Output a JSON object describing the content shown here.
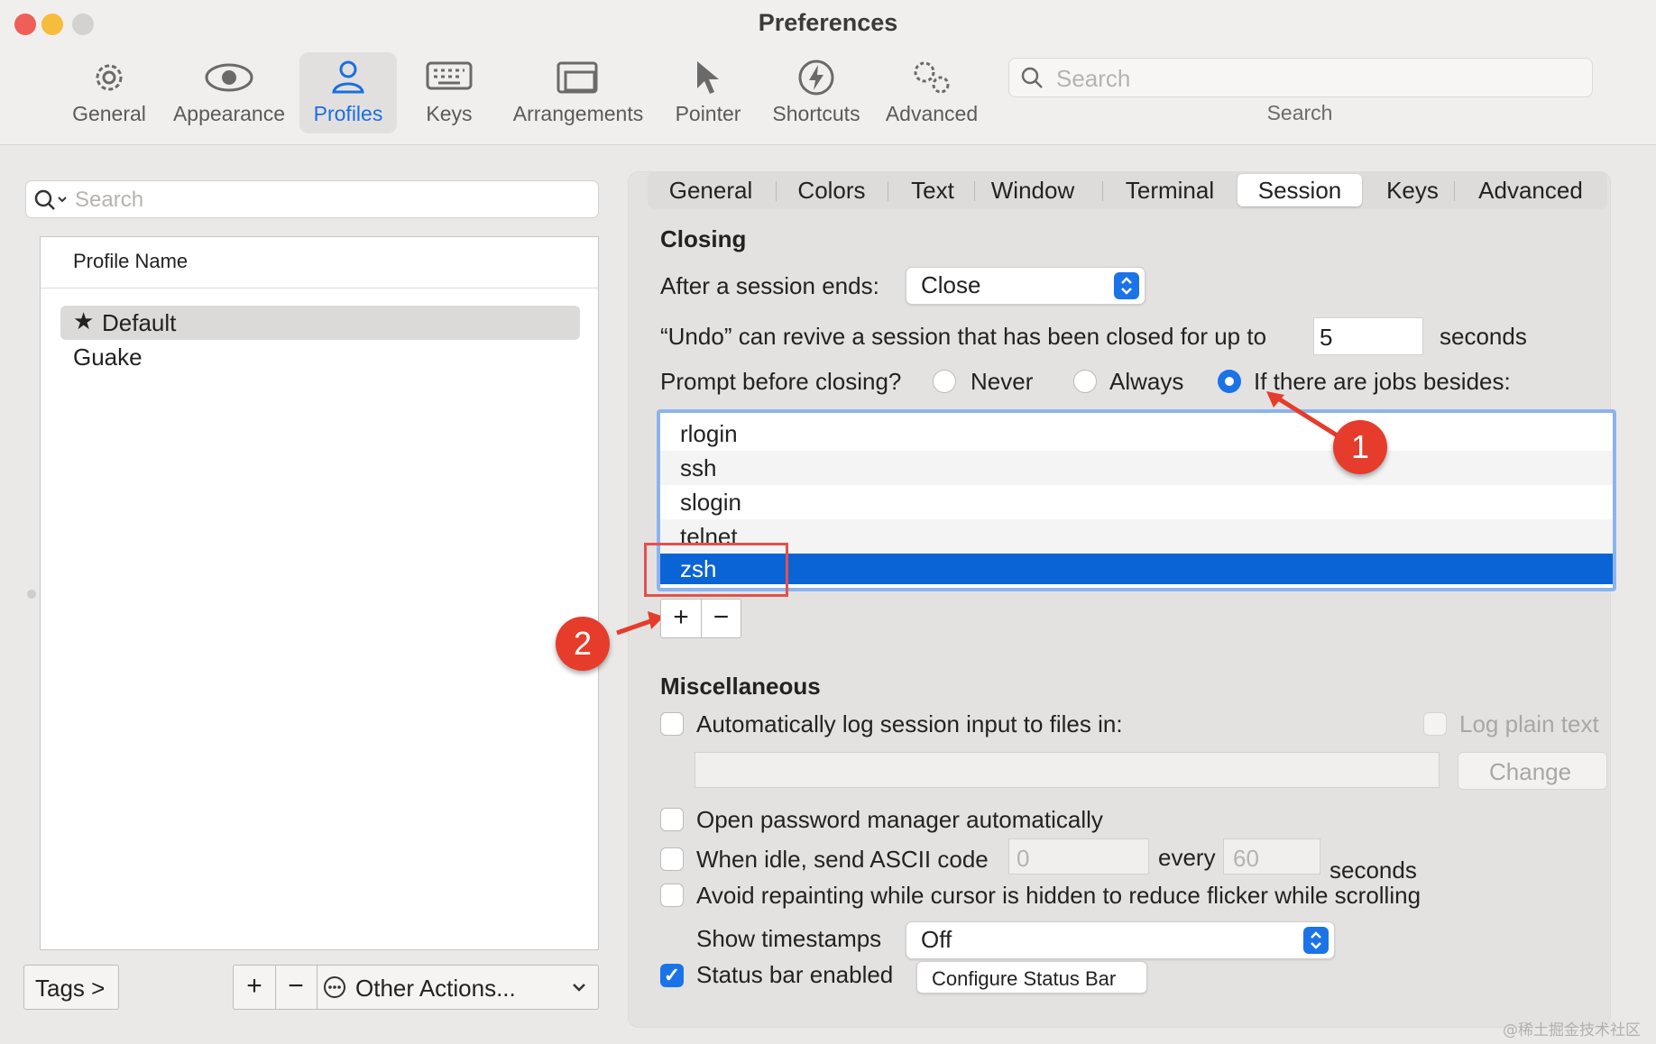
{
  "window": {
    "title": "Preferences"
  },
  "toolbar": {
    "items": [
      {
        "label": "General",
        "icon": "gear-icon"
      },
      {
        "label": "Appearance",
        "icon": "eye-icon"
      },
      {
        "label": "Profiles",
        "icon": "person-icon",
        "selected": true
      },
      {
        "label": "Keys",
        "icon": "keyboard-icon"
      },
      {
        "label": "Arrangements",
        "icon": "windows-icon"
      },
      {
        "label": "Pointer",
        "icon": "cursor-icon"
      },
      {
        "label": "Shortcuts",
        "icon": "bolt-icon"
      },
      {
        "label": "Advanced",
        "icon": "gears-icon"
      }
    ],
    "search_placeholder": "Search",
    "search_label": "Search"
  },
  "profiles": {
    "search_placeholder": "Search",
    "column_header": "Profile Name",
    "items": [
      {
        "name": "Default",
        "default": true,
        "selected": true
      },
      {
        "name": "Guake",
        "default": false
      }
    ],
    "tags_label": "Tags >",
    "add_label": "+",
    "remove_label": "−",
    "other_actions_label": "Other Actions..."
  },
  "tabs": {
    "items": [
      "General",
      "Colors",
      "Text",
      "Window",
      "Terminal",
      "Session",
      "Keys",
      "Advanced"
    ],
    "selected": "Session"
  },
  "closing": {
    "heading": "Closing",
    "after_session_label": "After a session ends:",
    "after_session_value": "Close",
    "undo_prefix": "“Undo” can revive a session that has been closed for up to",
    "undo_value": "5",
    "undo_suffix": "seconds",
    "prompt_label": "Prompt before closing?",
    "radio_never": "Never",
    "radio_always": "Always",
    "radio_jobs": "If there are jobs besides:",
    "selected_option": "If there are jobs besides:",
    "jobs": [
      "rlogin",
      "ssh",
      "slogin",
      "telnet",
      "zsh"
    ],
    "selected_job": "zsh",
    "add_job": "+",
    "remove_job": "−"
  },
  "annotations": {
    "badge1": "1",
    "badge2": "2"
  },
  "misc": {
    "heading": "Miscellaneous",
    "auto_log_label": "Automatically log session input to files in:",
    "auto_log_checked": false,
    "log_plain_label": "Log plain text",
    "change_label": "Change",
    "log_path_value": "",
    "password_mgr_label": "Open password manager automatically",
    "idle_label": "When idle, send ASCII code",
    "idle_code": "0",
    "every_label": "every",
    "idle_seconds": "60",
    "seconds_label": "seconds",
    "avoid_repaint_label": "Avoid repainting while cursor is hidden to reduce flicker while scrolling",
    "timestamps_label": "Show timestamps",
    "timestamps_value": "Off",
    "status_bar_label": "Status bar enabled",
    "status_bar_checked": true,
    "configure_status_label": "Configure Status Bar"
  },
  "watermark": "@稀土掘金技术社区",
  "colors": {
    "accent": "#1b73e8",
    "selection": "#0a64d6",
    "annotation": "#e53c2c"
  }
}
